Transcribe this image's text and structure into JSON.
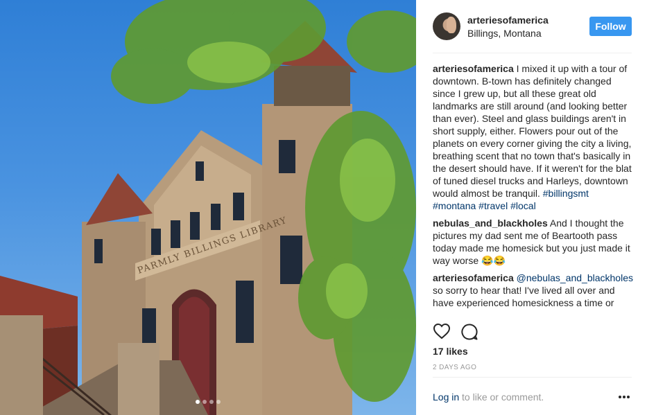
{
  "post": {
    "username": "arteriesofamerica",
    "location": "Billings, Montana",
    "follow_label": "Follow",
    "carousel_dots": 4,
    "carousel_active": 0
  },
  "photo": {
    "sign_text": "PARMLY BILLINGS LIBRARY",
    "alt": ""
  },
  "comments": [
    {
      "user": "arteriesofamerica",
      "text": "I mixed it up with a tour of downtown. B-town has definitely changed since I grew up, but all these great old landmarks are still around (and looking better than ever). Steel and glass buildings aren't in short supply, either. Flowers pour out of the planets on every corner giving the city a living, breathing scent that no town that's basically in the desert should have. If it weren't for the blat of tuned diesel trucks and Harleys, downtown would almost be tranquil.",
      "tags": [
        "#billingsmt",
        "#montana",
        "#travel",
        "#local"
      ]
    },
    {
      "user": "nebulas_and_blackholes",
      "text": "And I thought the pictures my dad sent me of Beartooth pass today made me homesick but you just made it way worse 😂😂"
    },
    {
      "user": "arteriesofamerica",
      "mention": "@nebulas_and_blackholes",
      "text": "so sorry to hear that! I've lived all over and have experienced homesickness a time or"
    }
  ],
  "likes": "17 likes",
  "time_ago": "2 DAYS AGO",
  "footer": {
    "login_link": "Log in",
    "login_rest": "to like or comment.",
    "more_icon": "ellipsis-icon"
  },
  "colors": {
    "follow": "#3897f0",
    "link": "#003569",
    "muted": "#999999"
  }
}
